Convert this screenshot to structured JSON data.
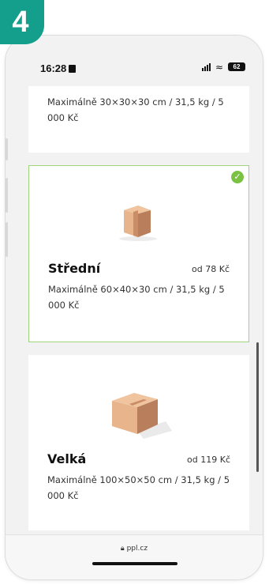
{
  "step": {
    "number": "4",
    "color": "#149e8c"
  },
  "status_bar": {
    "time": "16:28",
    "battery": "62"
  },
  "cards": [
    {
      "size": "",
      "price": "",
      "description": "Maximálně 30×30×30 cm / 31,5 kg / 5 000 Kč",
      "selected": false
    },
    {
      "size": "Střední",
      "price": "od 78 Kč",
      "description": "Maximálně 60×40×30 cm / 31,5 kg / 5 000 Kč",
      "selected": true,
      "selected_icon": "check-icon"
    },
    {
      "size": "Velká",
      "price": "od 119 Kč",
      "description": "Maximálně 100×50×50 cm / 31,5 kg / 5 000 Kč",
      "selected": false
    }
  ],
  "browser": {
    "url": "ppl.cz"
  },
  "colors": {
    "accent": "#7cc242",
    "selected_border": "#9fd37c",
    "box": "#e3a77a"
  }
}
